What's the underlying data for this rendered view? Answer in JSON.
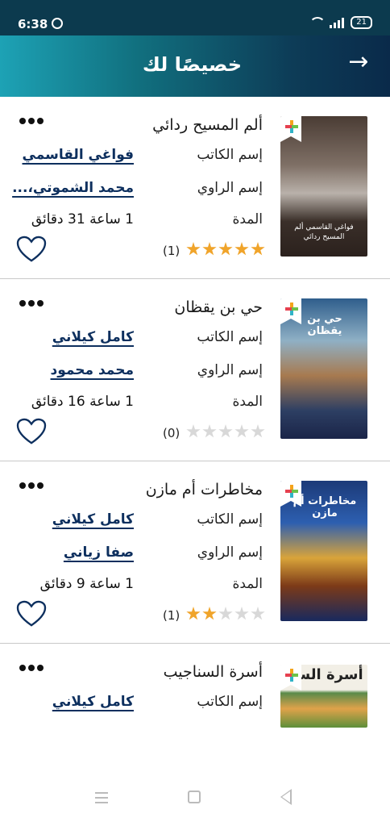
{
  "status": {
    "time": "6:38",
    "battery": "21"
  },
  "header": {
    "title": "خصيصًا لك",
    "back_icon": "arrow-right-icon"
  },
  "labels": {
    "author": "إسم الكاتب",
    "narrator": "إسم الراوي",
    "duration": "المدة"
  },
  "books": [
    {
      "title": "ألم المسيح ردائي",
      "author": "فواغي القاسمي",
      "narrator": "محمد الشموتي،...",
      "duration": "1 ساعة 31 دقائق",
      "rating": 5,
      "rating_count": "(1)",
      "cover_text": "فواغي القاسمي ألم المسيح ردائي"
    },
    {
      "title": "حي بن يقظان",
      "author": "كامل كيلاني",
      "narrator": "محمد محمود",
      "duration": "1 ساعة 16 دقائق",
      "rating": 0,
      "rating_count": "(0)",
      "cover_text": "حي بن يقظان"
    },
    {
      "title": "مخاطرات أم مازن",
      "author": "كامل كيلاني",
      "narrator": "صفا زياني",
      "duration": "1 ساعة 9 دقائق",
      "rating": 2,
      "rating_count": "(1)",
      "cover_text": "مخاطرات أم مازن"
    },
    {
      "title": "أسرة السناجيب",
      "author": "كامل كيلاني",
      "cover_text": "أسرة السنا"
    }
  ],
  "colors": {
    "accent": "#0d2f5e",
    "star": "#f0a42a",
    "header_start": "#1da2b5",
    "header_end": "#0a2a4a"
  }
}
